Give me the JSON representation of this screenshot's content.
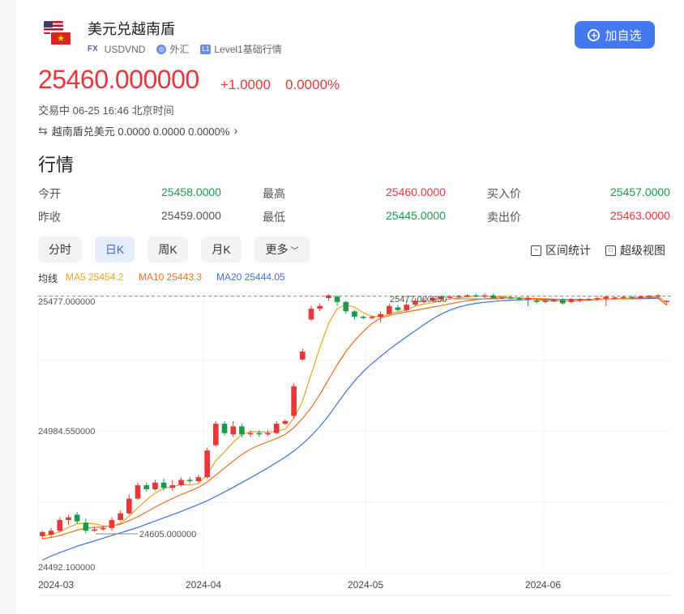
{
  "header": {
    "title": "美元兑越南盾",
    "tag_fx": "FX",
    "code": "USDVND",
    "market": "外汇",
    "level": "L1",
    "level_label": "Level1基础行情",
    "add_button": "加自选"
  },
  "quote": {
    "price": "25460.000000",
    "change": "+1.0000",
    "change_pct": "0.0000%",
    "status": "交易中 06-25 16:46 北京时间",
    "inverse": "越南盾兑美元 0.0000 0.0000 0.0000%"
  },
  "market_section": {
    "title": "行情",
    "rows": [
      [
        {
          "label": "今开",
          "value": "25458.0000"
        },
        {
          "label": "最高",
          "value": "25460.0000"
        },
        {
          "label": "买入价",
          "value": "25457.0000"
        }
      ],
      [
        {
          "label": "昨收",
          "value": "25459.0000"
        },
        {
          "label": "最低",
          "value": "25445.0000"
        },
        {
          "label": "卖出价",
          "value": "25463.0000"
        }
      ]
    ]
  },
  "tabs": [
    {
      "label": "分时"
    },
    {
      "label": "日K"
    },
    {
      "label": "周K"
    },
    {
      "label": "月K"
    },
    {
      "label": "更多"
    }
  ],
  "tools": {
    "range": "区间统计",
    "super": "超级视图"
  },
  "ma_legend": {
    "label": "均线",
    "ma5": "MA5 25454.2",
    "ma10": "MA10 25443.3",
    "ma20": "MA20 25444.05"
  },
  "colors": {
    "up": "#e8363a",
    "down": "#1a9b4b",
    "accent": "#4478f0",
    "ma5": "#f0a21e",
    "ma10": "#f06d1e",
    "ma20": "#3e6fe6"
  },
  "chart_data": {
    "type": "candlestick",
    "ylim": [
      24440,
      25500
    ],
    "y_labels": [
      "25477.000000",
      "24984.550000",
      "24492.100000"
    ],
    "x_labels": [
      "2024-03",
      "2024-04",
      "2024-05",
      "2024-06"
    ],
    "annot_high": "25477.000000",
    "annot_low": "24605.000000",
    "ref_line": 25477,
    "candles": [
      [
        24580,
        24595,
        24570,
        24600
      ],
      [
        24585,
        24600,
        24575,
        24610
      ],
      [
        24600,
        24640,
        24595,
        24650
      ],
      [
        24640,
        24650,
        24620,
        24660
      ],
      [
        24660,
        24635,
        24625,
        24670
      ],
      [
        24630,
        24600,
        24590,
        24645
      ],
      [
        24600,
        24605,
        24595,
        24615
      ],
      [
        24605,
        24610,
        24600,
        24620
      ],
      [
        24610,
        24640,
        24600,
        24650
      ],
      [
        24640,
        24665,
        24635,
        24675
      ],
      [
        24665,
        24720,
        24660,
        24735
      ],
      [
        24720,
        24770,
        24715,
        24780
      ],
      [
        24770,
        24755,
        24745,
        24780
      ],
      [
        24755,
        24780,
        24750,
        24790
      ],
      [
        24780,
        24760,
        24750,
        24795
      ],
      [
        24760,
        24770,
        24750,
        24790
      ],
      [
        24770,
        24790,
        24765,
        24800
      ],
      [
        24790,
        24785,
        24775,
        24800
      ],
      [
        24785,
        24800,
        24780,
        24810
      ],
      [
        24800,
        24900,
        24795,
        24910
      ],
      [
        24920,
        25000,
        24915,
        25010
      ],
      [
        25000,
        24965,
        24955,
        25010
      ],
      [
        24960,
        24990,
        24950,
        25010
      ],
      [
        24990,
        24960,
        24950,
        25000
      ],
      [
        24960,
        24965,
        24950,
        24975
      ],
      [
        24965,
        24960,
        24950,
        24975
      ],
      [
        24960,
        24965,
        24955,
        24975
      ],
      [
        24965,
        25000,
        24960,
        25010
      ],
      [
        25000,
        25010,
        24995,
        25015
      ],
      [
        25030,
        25140,
        25020,
        25150
      ],
      [
        25240,
        25270,
        25235,
        25280
      ],
      [
        25390,
        25430,
        25385,
        25440
      ],
      [
        25430,
        25440,
        25420,
        25450
      ],
      [
        25470,
        25480,
        25460,
        25485
      ],
      [
        25475,
        25455,
        25440,
        25480
      ],
      [
        25455,
        25420,
        25410,
        25460
      ],
      [
        25420,
        25400,
        25390,
        25425
      ],
      [
        25400,
        25395,
        25390,
        25405
      ],
      [
        25395,
        25400,
        25390,
        25405
      ],
      [
        25400,
        25410,
        25380,
        25420
      ],
      [
        25410,
        25440,
        25405,
        25450
      ],
      [
        25435,
        25425,
        25420,
        25445
      ],
      [
        25425,
        25445,
        25420,
        25460
      ],
      [
        25445,
        25460,
        25440,
        25470
      ],
      [
        25455,
        25460,
        25450,
        25470
      ],
      [
        25460,
        25470,
        25455,
        25475
      ],
      [
        25465,
        25475,
        25460,
        25480
      ],
      [
        25470,
        25475,
        25465,
        25480
      ],
      [
        25475,
        25478,
        25470,
        25482
      ],
      [
        25478,
        25480,
        25472,
        25484
      ],
      [
        25480,
        25477,
        25472,
        25486
      ],
      [
        25477,
        25480,
        25470,
        25486
      ],
      [
        25480,
        25470,
        25465,
        25486
      ],
      [
        25470,
        25472,
        25465,
        25478
      ],
      [
        25472,
        25470,
        25465,
        25478
      ],
      [
        25470,
        25468,
        25460,
        25475
      ],
      [
        25465,
        25470,
        25440,
        25475
      ],
      [
        25460,
        25455,
        25450,
        25468
      ],
      [
        25455,
        25460,
        25450,
        25465
      ],
      [
        25460,
        25462,
        25455,
        25466
      ],
      [
        25462,
        25450,
        25445,
        25470
      ],
      [
        25455,
        25465,
        25450,
        25470
      ],
      [
        25462,
        25465,
        25455,
        25470
      ],
      [
        25465,
        25466,
        25460,
        25472
      ],
      [
        25466,
        25470,
        25460,
        25475
      ],
      [
        25468,
        25475,
        25440,
        25478
      ],
      [
        25470,
        25472,
        25465,
        25476
      ],
      [
        25472,
        25474,
        25465,
        25478
      ],
      [
        25474,
        25472,
        25466,
        25478
      ],
      [
        25470,
        25476,
        25465,
        25480
      ],
      [
        25474,
        25478,
        25468,
        25482
      ],
      [
        25476,
        25480,
        25470,
        25484
      ],
      [
        25458,
        25460,
        25445,
        25460
      ]
    ],
    "ma5": [
      24580,
      24586,
      24596,
      24612,
      24626,
      24628,
      24626,
      24618,
      24617,
      24628,
      24654,
      24685,
      24715,
      24740,
      24759,
      24764,
      24773,
      24771,
      24776,
      24810,
      24862,
      24895,
      24930,
      24960,
      24970,
      24970,
      24968,
      24972,
      24980,
      25020,
      25085,
      25185,
      25285,
      25375,
      25430,
      25445,
      25436,
      25415,
      25402,
      25400,
      25412,
      25418,
      25425,
      25440,
      25447,
      25452,
      25460,
      25466,
      25470,
      25475,
      25477,
      25477,
      25476,
      25474,
      25472,
      25470,
      25466,
      25462,
      25460,
      25458,
      25458,
      25458,
      25460,
      25462,
      25464,
      25465,
      25466,
      25468,
      25470,
      25472,
      25474,
      25476,
      25454
    ],
    "ma10": [
      24570,
      24575,
      24582,
      24592,
      24602,
      24610,
      24612,
      24614,
      24618,
      24624,
      24638,
      24652,
      24670,
      24688,
      24705,
      24720,
      24735,
      24748,
      24762,
      24782,
      24808,
      24834,
      24860,
      24885,
      24905,
      24920,
      24932,
      24945,
      24960,
      24985,
      25020,
      25060,
      25110,
      25165,
      25220,
      25270,
      25310,
      25345,
      25375,
      25395,
      25405,
      25412,
      25418,
      25424,
      25430,
      25436,
      25442,
      25448,
      25454,
      25460,
      25464,
      25467,
      25469,
      25470,
      25470,
      25470,
      25469,
      25468,
      25467,
      25466,
      25465,
      25465,
      25465,
      25465,
      25466,
      25466,
      25467,
      25468,
      25469,
      25470,
      25471,
      25472,
      25443
    ],
    "ma20": [
      24490,
      24505,
      24518,
      24530,
      24542,
      24552,
      24562,
      24572,
      24582,
      24592,
      24602,
      24612,
      24624,
      24636,
      24648,
      24660,
      24672,
      24685,
      24698,
      24712,
      24728,
      24745,
      24762,
      24780,
      24798,
      24816,
      24835,
      24855,
      24875,
      24898,
      24925,
      24955,
      24990,
      25030,
      25075,
      25120,
      25160,
      25195,
      25225,
      25252,
      25278,
      25302,
      25325,
      25348,
      25370,
      25392,
      25410,
      25425,
      25436,
      25444,
      25450,
      25454,
      25457,
      25460,
      25462,
      25463,
      25464,
      25464,
      25464,
      25464,
      25464,
      25464,
      25464,
      25465,
      25465,
      25466,
      25466,
      25467,
      25467,
      25468,
      25468,
      25469,
      25444
    ]
  }
}
